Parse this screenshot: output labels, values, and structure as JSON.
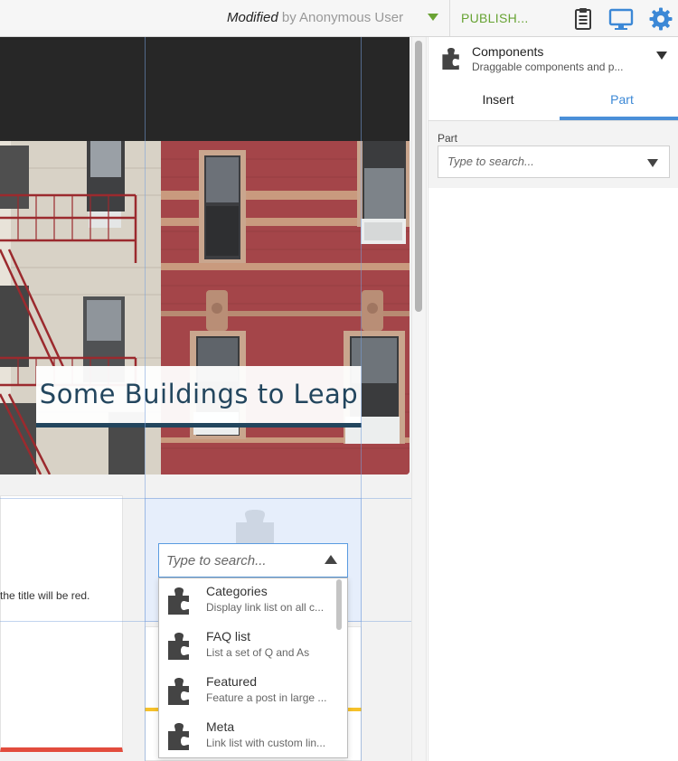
{
  "toolbar": {
    "status_state": "Modified",
    "status_by": "by Anonymous User",
    "publish_label": "PUBLISH...",
    "icons": [
      "clipboard-icon",
      "monitor-icon",
      "gear-icon"
    ],
    "accent_color": "#67a333",
    "icon_color": "#3c88d6"
  },
  "preview": {
    "hero_title": "Some Buildings to Leap",
    "card_text": "the title will be red.",
    "search_placeholder": "Type to search...",
    "parts": [
      {
        "name": "Categories",
        "desc": "Display link list on all c..."
      },
      {
        "name": "FAQ list",
        "desc": "List a set of Q and As"
      },
      {
        "name": "Featured",
        "desc": "Feature a post in large ..."
      },
      {
        "name": "Meta",
        "desc": "Link list with custom lin..."
      }
    ]
  },
  "panel": {
    "title": "Components",
    "subtitle": "Draggable components and p...",
    "tabs": [
      "Insert",
      "Part"
    ],
    "active_tab": "Part",
    "field_label": "Part",
    "field_placeholder": "Type to search..."
  }
}
